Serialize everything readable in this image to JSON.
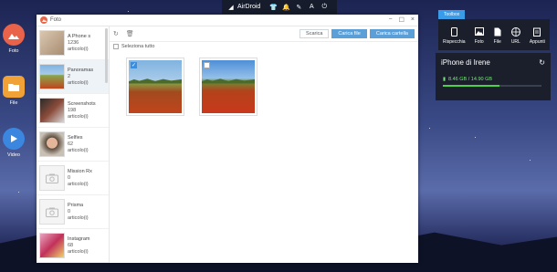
{
  "topbar": {
    "brand": "AirDroid"
  },
  "dock": [
    {
      "label": "Foto",
      "color": "#e8634a"
    },
    {
      "label": "File",
      "color": "#f0a236"
    },
    {
      "label": "Video",
      "color": "#3b87e0"
    }
  ],
  "window": {
    "title": "Foto",
    "toolbar": {
      "download": "Scarica",
      "upload_file": "Carica file",
      "upload_folder": "Carica cartella"
    },
    "select_all": "Seleziona tutto",
    "albums": [
      {
        "name": "A Phone s",
        "count": "1236",
        "unit": "articolo(i)",
        "thumb": "photo"
      },
      {
        "name": "Panoramas",
        "count": "2",
        "unit": "articolo(i)",
        "thumb": "field"
      },
      {
        "name": "Screenshots",
        "count": "198",
        "unit": "articolo(i)",
        "thumb": "screenshot"
      },
      {
        "name": "Selfies",
        "count": "62",
        "unit": "articolo(i)",
        "thumb": "selfie"
      },
      {
        "name": "Mission Rx",
        "count": "0",
        "unit": "articolo(i)",
        "thumb": "placeholder"
      },
      {
        "name": "Prisma",
        "count": "0",
        "unit": "articolo(i)",
        "thumb": "placeholder"
      },
      {
        "name": "Instagram",
        "count": "68",
        "unit": "articolo(i)",
        "thumb": "instagram"
      }
    ],
    "photos": [
      {
        "selected": true
      },
      {
        "selected": false
      }
    ]
  },
  "toolbox": {
    "tab": "Toolbox",
    "items": [
      "Rispecchia",
      "Foto",
      "File",
      "URL",
      "Appunti"
    ]
  },
  "device": {
    "name": "iPhone di Irene",
    "storage": "8.46 GB / 14.90 GB",
    "storage_fraction": 0.57
  }
}
